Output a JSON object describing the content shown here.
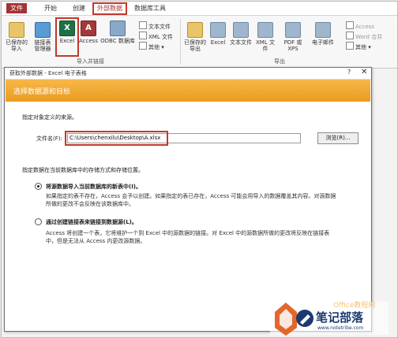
{
  "tabs": {
    "file": "文件",
    "start": "开始",
    "create": "创建",
    "external": "外部数据",
    "dbtools": "数据库工具"
  },
  "ribbon": {
    "import_group": "导入并链接",
    "export_group": "导出",
    "saved_import": "已保存的\n导入",
    "link_manager": "链接表\n管理器",
    "excel": "Excel",
    "access": "Access",
    "odbc": "ODBC 数据库",
    "text_file": "文本文件",
    "xml_file": "XML 文件",
    "more": "其他",
    "saved_export": "已保存的\n导出",
    "exp_excel": "Excel",
    "exp_text": "文本文件",
    "exp_xml": "XML 文件",
    "exp_pdf": "PDF 或 XPS",
    "exp_email": "电子邮件",
    "exp_access": "Access",
    "exp_word": "Word 合并",
    "exp_more": "其他"
  },
  "dialog": {
    "title": "获取外部数据 - Excel 电子表格",
    "help": "?",
    "close": "✕",
    "header": "选择数据源和目标",
    "source_label": "指定对象定义的来源。",
    "filename_label": "文件名(F):",
    "filename_value": "C:\\Users\\chenxilu\\Desktop\\A.xlsx",
    "browse": "浏览(R)...",
    "storage_label": "指定数据在当前数据库中的存储方式和存储位置。",
    "option1_title": "将源数据导入当前数据库的新表中(I)。",
    "option1_desc_1": "如果指定的表不存在，Access 会予以创建。如果指定的表已存在，Access 可能会用导入的数据覆盖其内容。对源数据",
    "option1_desc_2": "所做的更改不会反映在该数据库中。",
    "option2_title": "通过创建链接表来链接到数据源(L)。",
    "option2_desc_1": "Access 将创建一个表，它将维护一个到 Excel 中的源数据的链接。对 Excel 中的源数据所做的更改将反映在链接表",
    "option2_desc_2": "中，但是无法从 Access 内更改源数据。"
  },
  "watermark": {
    "brand": "笔记部落",
    "url": "www.notetribe.com",
    "office": "Office教程网"
  }
}
